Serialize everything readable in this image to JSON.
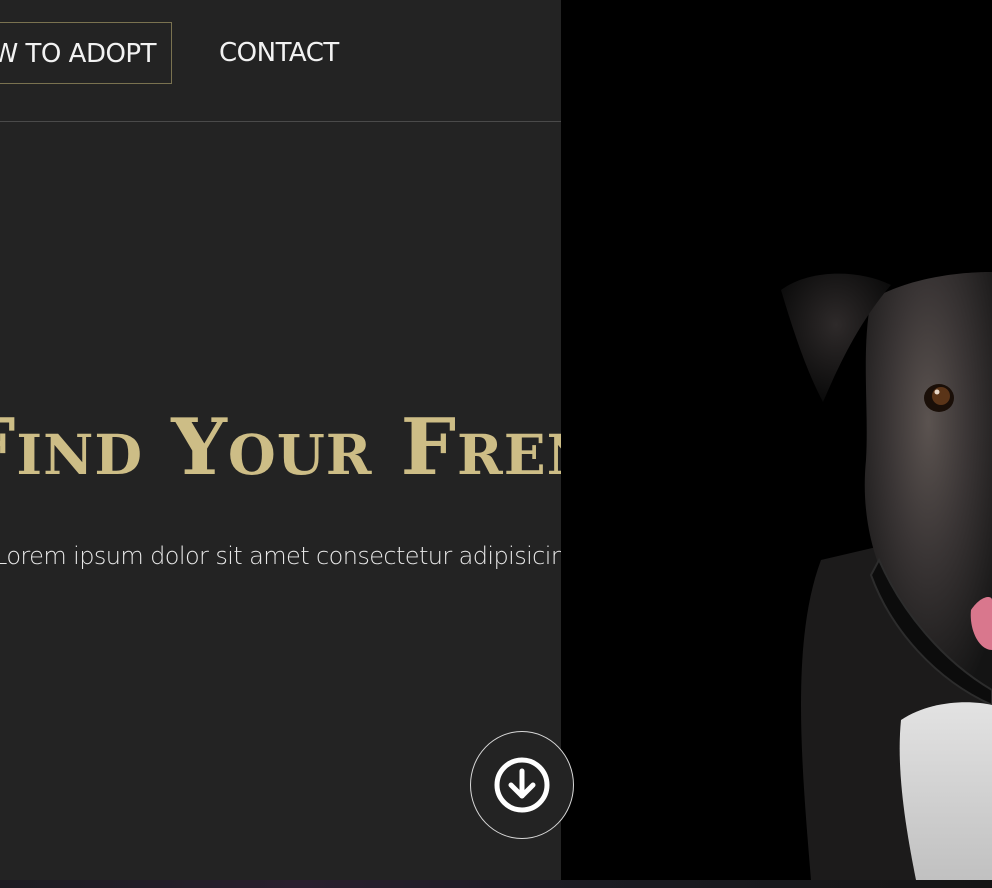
{
  "nav": {
    "items": [
      {
        "label": "HOW TO ADOPT",
        "active": true
      },
      {
        "label": "CONTACT",
        "active": false
      }
    ]
  },
  "hero": {
    "title": "Find Your Frend",
    "text": "Lorem ipsum dolor sit amet consectetur adipisicing elit. Voluptates,"
  },
  "scroll_button": {
    "icon": "arrow-down-circle-icon"
  },
  "photo": {
    "subject": "dog-photo"
  },
  "colors": {
    "background": "#232323",
    "accent_gold": "#cdbd86",
    "photo_background": "#000000",
    "nav_border": "#7a7250"
  }
}
